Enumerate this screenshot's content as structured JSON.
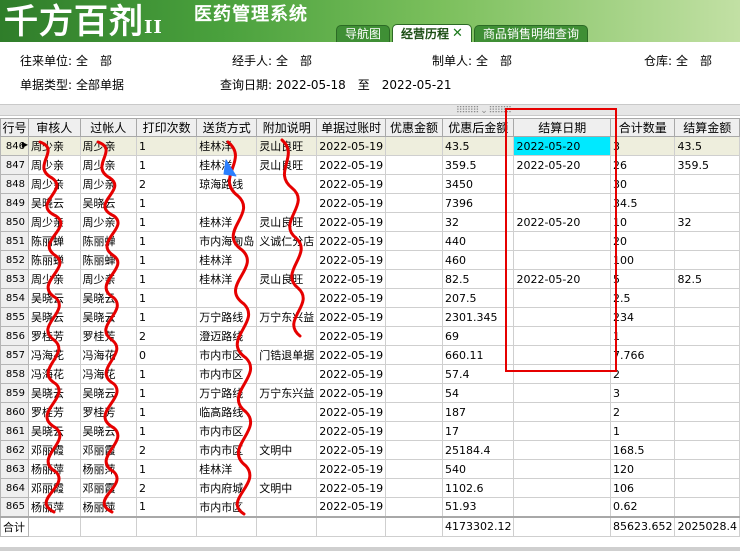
{
  "header": {
    "logo_text": "千方百剂",
    "logo_mark": "II",
    "system_title": "医药管理系统",
    "tabs": [
      {
        "label": "导航图",
        "active": false
      },
      {
        "label": "经营历程",
        "active": true,
        "close": "✕"
      },
      {
        "label": "商品销售明细查询",
        "active": false
      }
    ]
  },
  "filters": {
    "partner_label": "往来单位:",
    "partner_value": "全　部",
    "handler_label": "经手人:",
    "handler_value": "全　部",
    "maker_label": "制单人:",
    "maker_value": "全　部",
    "warehouse_label": "仓库:",
    "warehouse_value": "全　部",
    "doctype_label": "单据类型:",
    "doctype_value": "全部单据",
    "date_label": "查询日期:",
    "date_value": "2022-05-18　至　2022-05-21"
  },
  "table": {
    "columns": [
      "行号",
      "审核人",
      "过帐人",
      "打印次数",
      "送货方式",
      "附加说明",
      "单据过账时",
      "优惠金额",
      "优惠后金额",
      "结算日期",
      "合计数量",
      "结算金额"
    ],
    "rows": [
      [
        "846",
        "周少亲",
        "周少亲",
        "1",
        "桂林洋",
        "灵山良旺",
        "2022-05-19",
        "",
        "43.5",
        "2022-05-20",
        "3",
        "43.5"
      ],
      [
        "847",
        "周少亲",
        "周少亲",
        "1",
        "桂林洋",
        "灵山良旺",
        "2022-05-19",
        "",
        "359.5",
        "2022-05-20",
        "26",
        "359.5"
      ],
      [
        "848",
        "周少亲",
        "周少亲",
        "2",
        "琼海路线",
        "",
        "2022-05-19",
        "",
        "3450",
        "",
        "30",
        ""
      ],
      [
        "849",
        "吴晓云",
        "吴晓云",
        "1",
        "",
        "",
        "2022-05-19",
        "",
        "7396",
        "",
        "34.5",
        ""
      ],
      [
        "850",
        "周少亲",
        "周少亲",
        "1",
        "桂林洋",
        "灵山良旺",
        "2022-05-19",
        "",
        "32",
        "2022-05-20",
        "10",
        "32"
      ],
      [
        "851",
        "陈丽蝉",
        "陈丽蝉",
        "1",
        "市内海甸岛",
        "义诚仁分店",
        "2022-05-19",
        "",
        "440",
        "",
        "20",
        ""
      ],
      [
        "852",
        "陈丽蝉",
        "陈丽蝉",
        "1",
        "桂林洋",
        "",
        "2022-05-19",
        "",
        "460",
        "",
        "100",
        ""
      ],
      [
        "853",
        "周少亲",
        "周少亲",
        "1",
        "桂林洋",
        "灵山良旺",
        "2022-05-19",
        "",
        "82.5",
        "2022-05-20",
        "5",
        "82.5"
      ],
      [
        "854",
        "吴晓云",
        "吴晓云",
        "1",
        "",
        "",
        "2022-05-19",
        "",
        "207.5",
        "",
        "2.5",
        ""
      ],
      [
        "855",
        "吴晓云",
        "吴晓云",
        "1",
        "万宁路线",
        "万宁东兴益",
        "2022-05-19",
        "",
        "2301.345",
        "",
        "234",
        ""
      ],
      [
        "856",
        "罗桂芳",
        "罗桂芳",
        "2",
        "澄迈路线",
        "",
        "2022-05-19",
        "",
        "69",
        "",
        "1",
        ""
      ],
      [
        "857",
        "冯海花",
        "冯海花",
        "0",
        "市内市区",
        "门锆退单据",
        "2022-05-19",
        "",
        "660.11",
        "",
        "7.766",
        ""
      ],
      [
        "858",
        "冯海花",
        "冯海花",
        "1",
        "市内市区",
        "",
        "2022-05-19",
        "",
        "57.4",
        "",
        "2",
        ""
      ],
      [
        "859",
        "吴晓云",
        "吴晓云",
        "1",
        "万宁路线",
        "万宁东兴益",
        "2022-05-19",
        "",
        "54",
        "",
        "3",
        ""
      ],
      [
        "860",
        "罗桂芳",
        "罗桂芳",
        "1",
        "临高路线",
        "",
        "2022-05-19",
        "",
        "187",
        "",
        "2",
        ""
      ],
      [
        "861",
        "吴晓云",
        "吴晓云",
        "1",
        "市内市区",
        "",
        "2022-05-19",
        "",
        "17",
        "",
        "1",
        ""
      ],
      [
        "862",
        "邓丽霞",
        "邓丽霞",
        "2",
        "市内市区",
        "文明中",
        "2022-05-19",
        "",
        "25184.4",
        "",
        "168.5",
        ""
      ],
      [
        "863",
        "杨丽萍",
        "杨丽萍",
        "1",
        "桂林洋",
        "",
        "2022-05-19",
        "",
        "540",
        "",
        "120",
        ""
      ],
      [
        "864",
        "邓丽霞",
        "邓丽霞",
        "2",
        "市内府城",
        "文明中",
        "2022-05-19",
        "",
        "1102.6",
        "",
        "106",
        ""
      ],
      [
        "865",
        "杨丽萍",
        "杨丽萍",
        "1",
        "市内市区",
        "",
        "2022-05-19",
        "",
        "51.93",
        "",
        "0.62",
        ""
      ]
    ],
    "footer": {
      "label": "合计",
      "after_discount_total": "4173302.12",
      "qty_total": "85623.652",
      "settle_total": "2025028.4"
    }
  },
  "splitter_grip": "⠿⠿⠿⠿ ⌄ ⠿⠿⠿⠿",
  "colors": {
    "banner": "#3f8f35",
    "highlight": "#00e9ff",
    "annotation": "#e60000"
  }
}
